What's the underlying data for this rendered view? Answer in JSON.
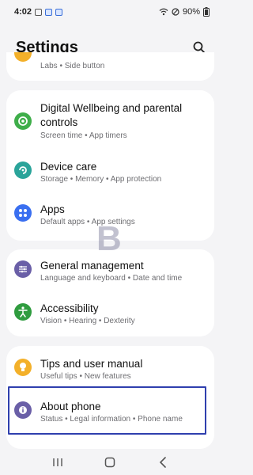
{
  "status_bar": {
    "time": "4:02",
    "battery": "90%"
  },
  "header": {
    "title": "Settings"
  },
  "partial_item": {
    "subtitle": "Labs  •  Side button"
  },
  "groups": [
    {
      "items": [
        {
          "title": "Digital Wellbeing and parental controls",
          "subtitle": "Screen time  •  App timers",
          "icon": "wellbeing-icon",
          "color": "#3fae4a"
        },
        {
          "title": "Device care",
          "subtitle": "Storage  •  Memory  •  App protection",
          "icon": "device-care-icon",
          "color": "#2aa49a"
        },
        {
          "title": "Apps",
          "subtitle": "Default apps  •  App settings",
          "icon": "apps-icon",
          "color": "#3a6ff0"
        }
      ]
    },
    {
      "items": [
        {
          "title": "General management",
          "subtitle": "Language and keyboard  •  Date and time",
          "icon": "sliders-icon",
          "color": "#6a5fa7"
        },
        {
          "title": "Accessibility",
          "subtitle": "Vision  •  Hearing  •  Dexterity",
          "icon": "accessibility-icon",
          "color": "#2f9c3f"
        }
      ]
    },
    {
      "items": [
        {
          "title": "Tips and user manual",
          "subtitle": "Useful tips  •  New features",
          "icon": "lightbulb-icon",
          "color": "#f3b02a"
        },
        {
          "title": "About phone",
          "subtitle": "Status  •  Legal information  •  Phone name",
          "icon": "info-icon",
          "color": "#6a5fa7"
        }
      ]
    }
  ],
  "watermark": "B",
  "nav": {
    "recent": "recent-apps-icon",
    "home": "home-icon",
    "back": "back-icon"
  }
}
